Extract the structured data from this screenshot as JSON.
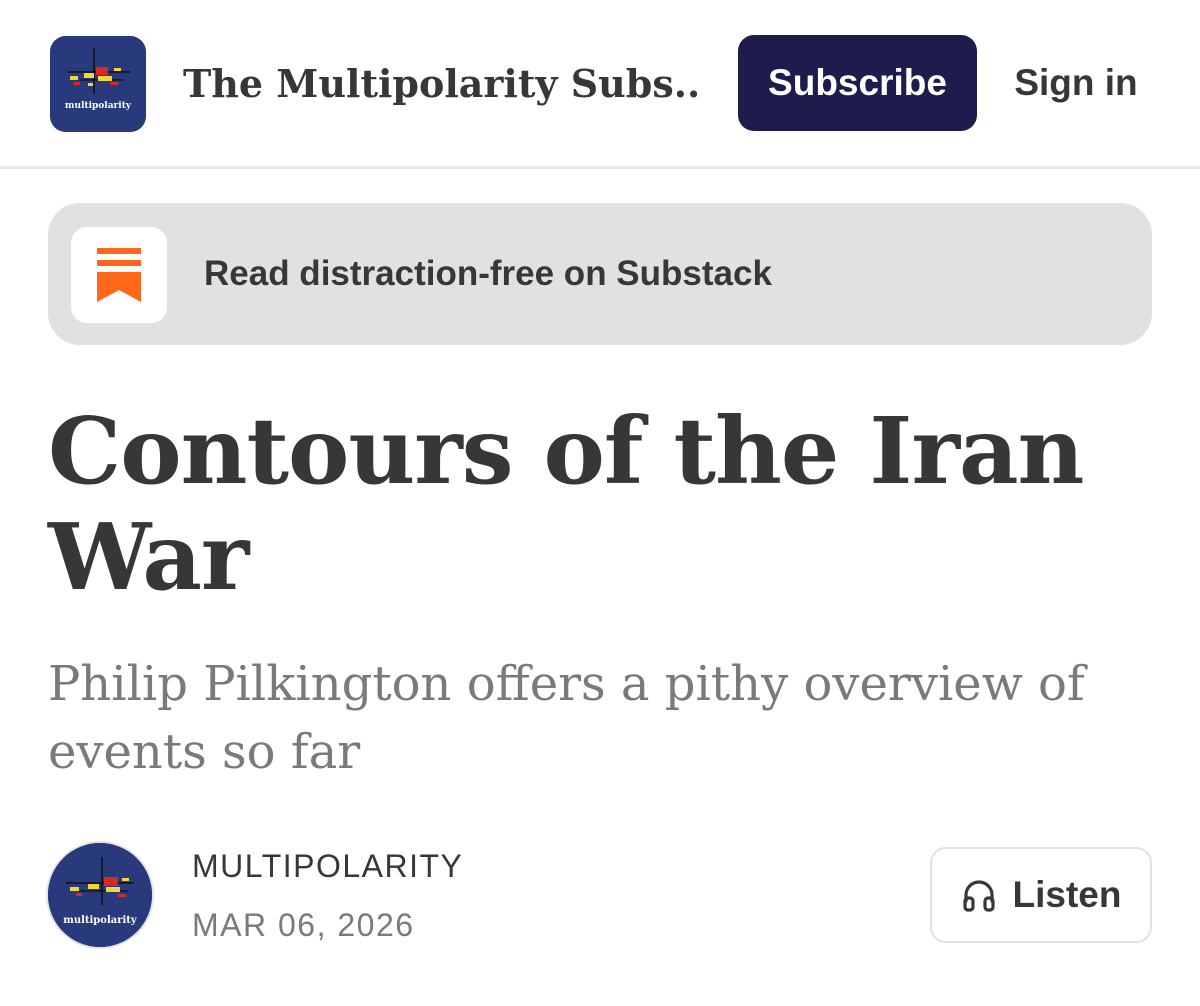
{
  "header": {
    "publication_name": "The Multipolarity Subs...",
    "logo_text": "multipolarity",
    "subscribe_label": "Subscribe",
    "signin_label": "Sign in"
  },
  "banner": {
    "text": "Read distraction-free on Substack",
    "icon": "substack-bookmark-icon"
  },
  "article": {
    "title": "Contours of the Iran War",
    "subtitle": "Philip Pilkington offers a pithy overview of events so far",
    "author": "MULTIPOLARITY",
    "date": "MAR 06, 2026",
    "listen_label": "Listen",
    "listen_icon": "headphones-icon"
  },
  "colors": {
    "logo_background": "#283a7c",
    "subscribe_button": "#1d1c4d",
    "substack_orange": "#ff6719",
    "text_primary": "#363737",
    "text_secondary": "#7a7a7a",
    "banner_background": "#e1e1e1"
  }
}
